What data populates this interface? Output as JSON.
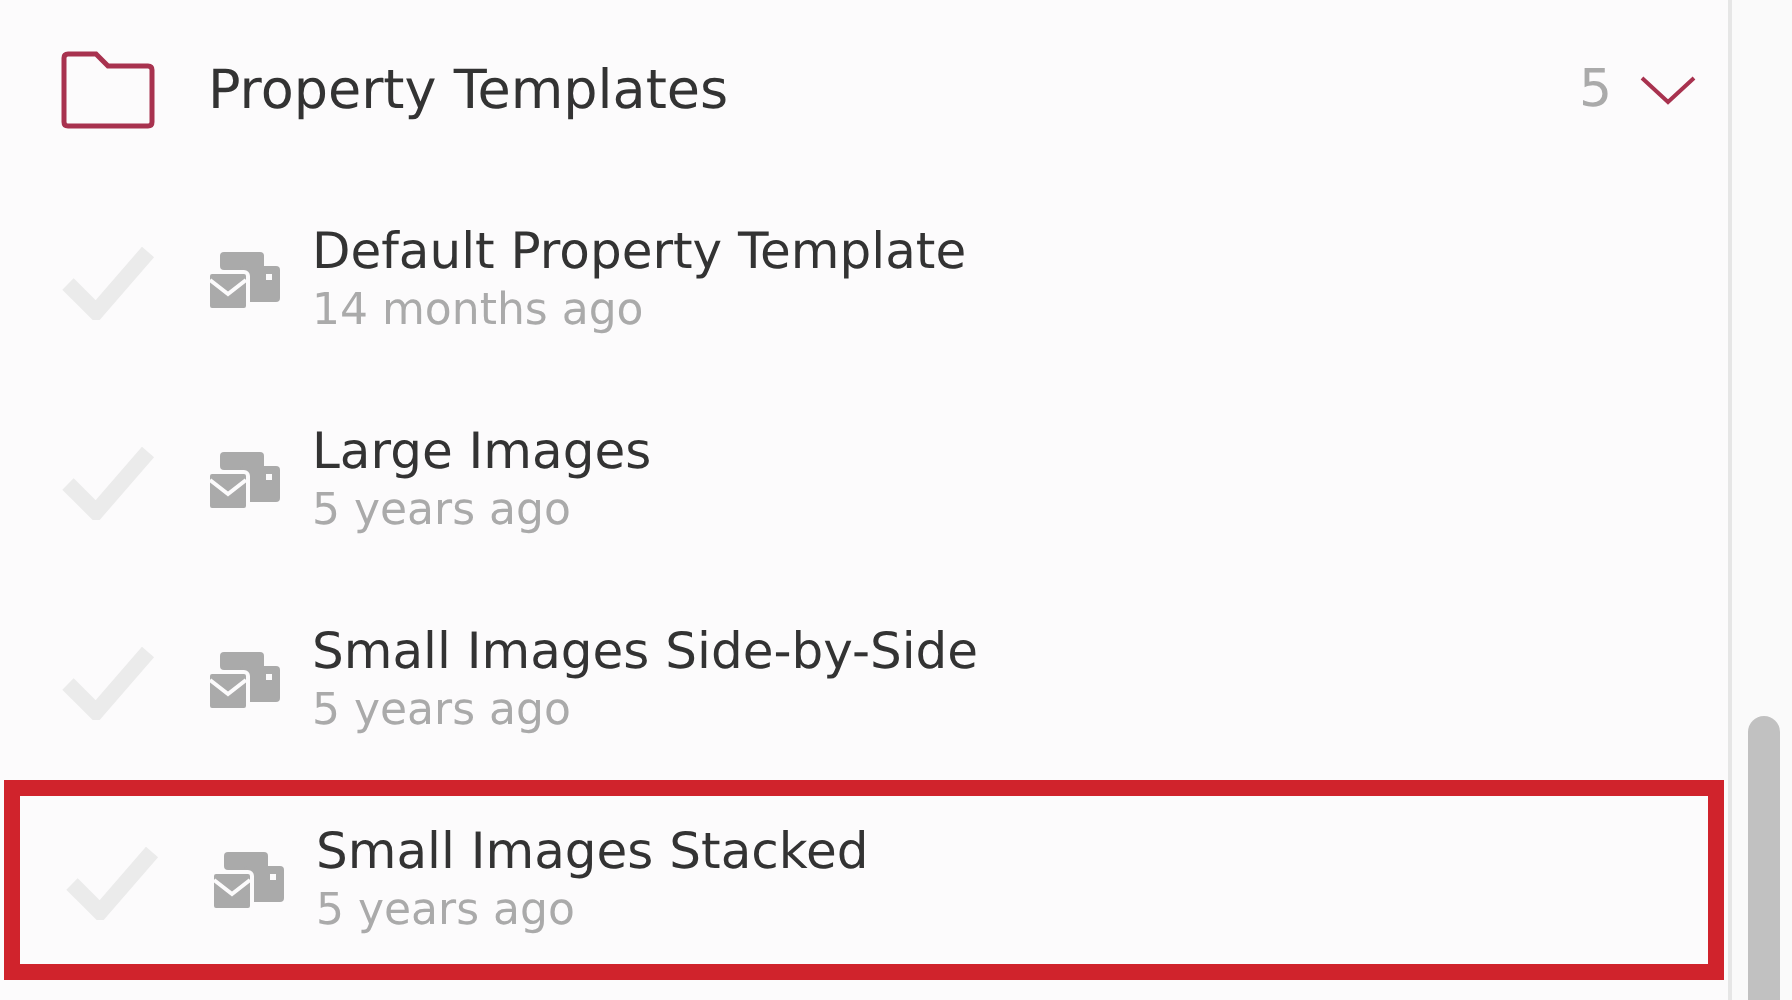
{
  "folder": {
    "title": "Property Templates",
    "count": "5",
    "expanded": true
  },
  "items": [
    {
      "name": "Default Property Template",
      "time": "14 months ago",
      "checked": false,
      "highlighted": false
    },
    {
      "name": "Large Images",
      "time": "5 years ago",
      "checked": false,
      "highlighted": false
    },
    {
      "name": "Small Images Side-by-Side",
      "time": "5 years ago",
      "checked": false,
      "highlighted": false
    },
    {
      "name": "Small Images Stacked",
      "time": "5 years ago",
      "checked": false,
      "highlighted": true
    }
  ]
}
